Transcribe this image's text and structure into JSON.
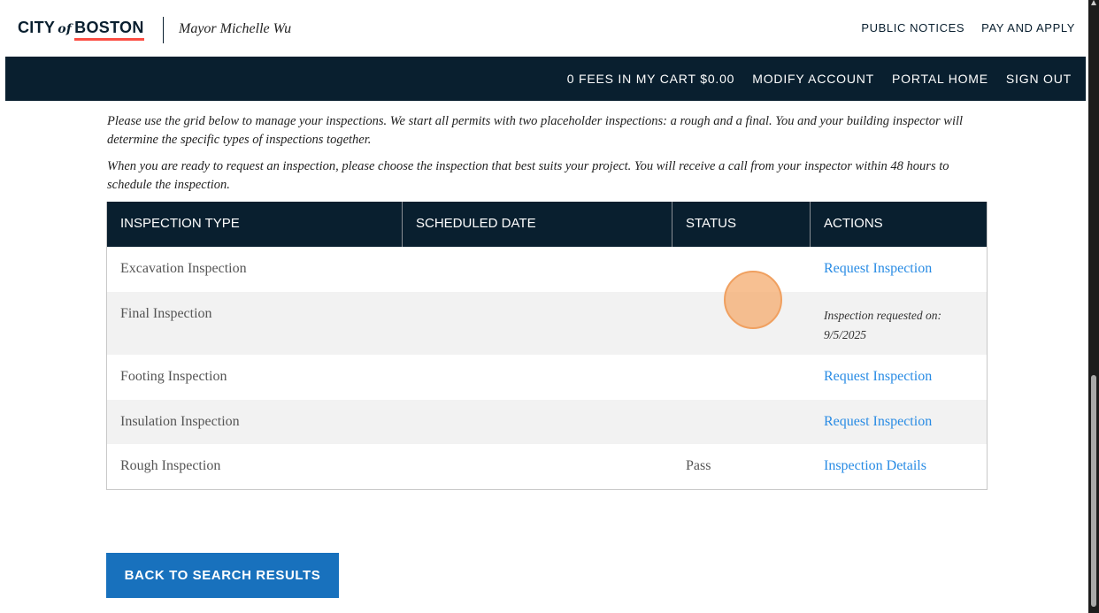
{
  "header": {
    "logo_city": "CITY",
    "logo_of": "of",
    "logo_boston": "BOSTON",
    "mayor": "Mayor Michelle Wu",
    "links": [
      "PUBLIC NOTICES",
      "PAY AND APPLY"
    ]
  },
  "nav": {
    "links": [
      "0 FEES IN MY CART $0.00",
      "MODIFY ACCOUNT",
      "PORTAL HOME",
      "SIGN OUT"
    ]
  },
  "intro": {
    "p1": "Please use the grid below to manage your inspections. We start all permits with two placeholder inspections: a rough and a final. You and your building inspector will determine the specific types of inspections together.",
    "p2": "When you are ready to request an inspection, please choose the inspection that best suits your project. You will receive a call from your inspector within 48 hours to schedule the inspection."
  },
  "table": {
    "columns": [
      "INSPECTION TYPE",
      "SCHEDULED DATE",
      "STATUS",
      "ACTIONS"
    ],
    "rows": [
      {
        "type": "Excavation Inspection",
        "date": "",
        "status": "",
        "action": "Request Inspection",
        "note": ""
      },
      {
        "type": "Final Inspection",
        "date": "",
        "status": "",
        "action": "",
        "note": "Inspection requested on:",
        "note_date": "9/5/2025"
      },
      {
        "type": "Footing Inspection",
        "date": "",
        "status": "",
        "action": "Request Inspection",
        "note": ""
      },
      {
        "type": "Insulation Inspection",
        "date": "",
        "status": "",
        "action": "Request Inspection",
        "note": ""
      },
      {
        "type": "Rough Inspection",
        "date": "",
        "status": "Pass",
        "action": "Inspection Details",
        "note": ""
      }
    ]
  },
  "back_button": "BACK TO SEARCH RESULTS",
  "colors": {
    "navy": "#091f2f",
    "link_blue": "#288be4",
    "button_blue": "#1871bd",
    "accent_red": "#fb4d42"
  }
}
